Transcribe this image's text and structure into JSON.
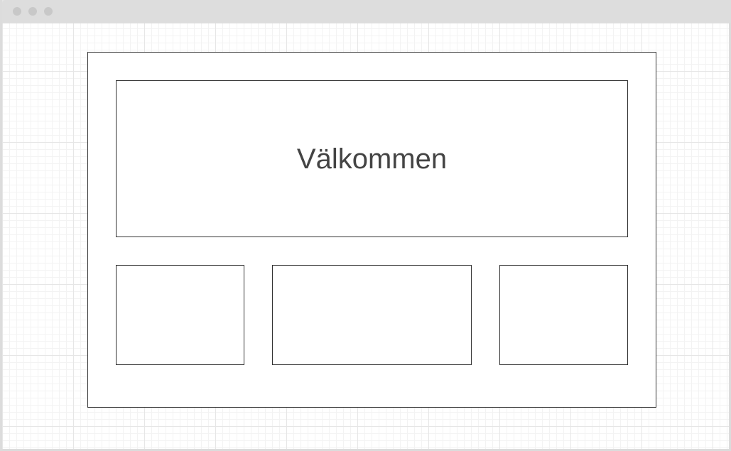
{
  "hero": {
    "title": "Välkommen"
  },
  "colors": {
    "titlebar": "#dddddd",
    "window_dots": "#c8c8c8",
    "border": "#333333",
    "text": "#444444",
    "grid_major": "#e6e6e6",
    "grid_minor": "#f3f3f3"
  }
}
